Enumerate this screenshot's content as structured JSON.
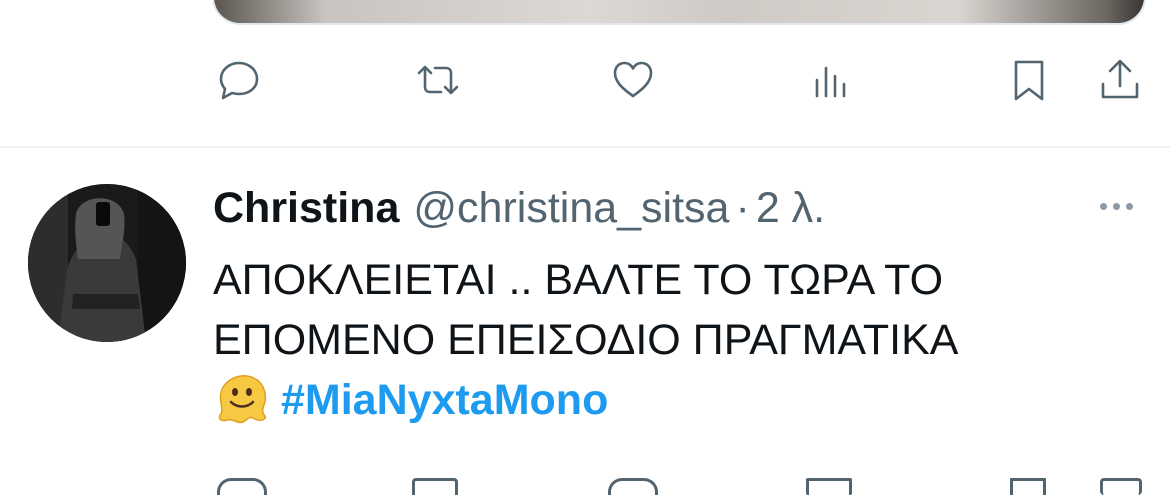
{
  "tweet_actions": {
    "reply_icon": "reply-icon",
    "retweet_icon": "retweet-icon",
    "like_icon": "heart-icon",
    "views_icon": "views-icon",
    "bookmark_icon": "bookmark-icon",
    "share_icon": "share-icon"
  },
  "tweet": {
    "display_name": "Christina",
    "handle": "@christina_sitsa",
    "separator": "·",
    "time": "2 λ.",
    "text_line_1": "ΑΠΟΚΛΕΙΕΤΑΙ .. ΒΑΛΤΕ ΤΟ ΤΩΡΑ ΤΟ",
    "text_line_2": "ΕΠΟΜΕΝΟ ΕΠΕΙΣΟΔΙΟ ΠΡΑΓΜΑΤΙΚΑ",
    "emoji": "melting-face-emoji",
    "hashtag": "#MiaNyxtaMono"
  },
  "colors": {
    "text_primary": "#0f1419",
    "text_secondary": "#536471",
    "link": "#1d9bf0",
    "divider": "#eff3f4"
  }
}
